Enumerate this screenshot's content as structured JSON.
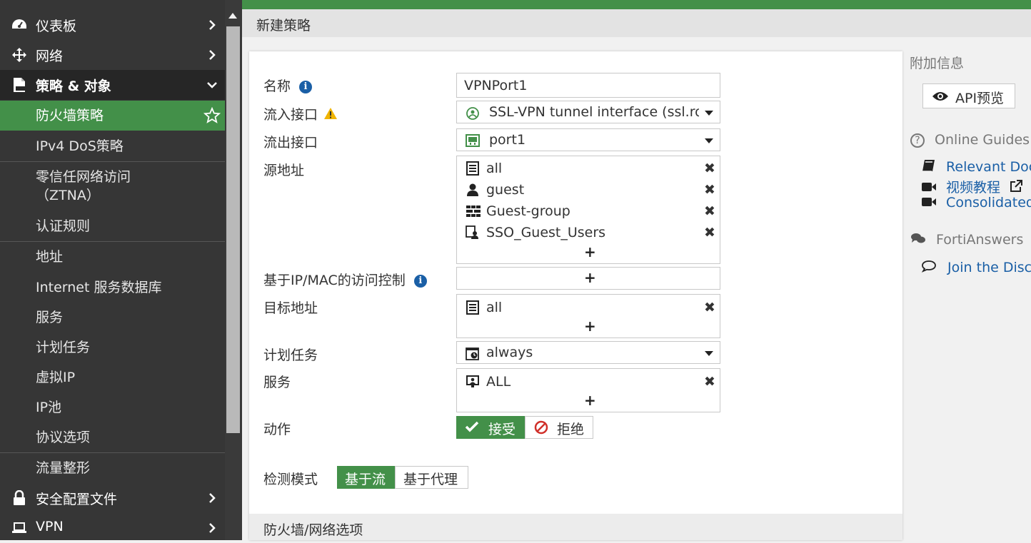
{
  "sidebar": {
    "top": [
      {
        "label": "仪表板",
        "icon": "dashboard-icon"
      },
      {
        "label": "网络",
        "icon": "move-arrows-icon"
      },
      {
        "label": "策略 & 对象",
        "icon": "policy-document-icon"
      }
    ],
    "sub": [
      {
        "label": "防火墙策略"
      },
      {
        "label": "IPv4 DoS策略"
      },
      {
        "label": "零信任网络访问\n（ZTNA）"
      },
      {
        "label": "认证规则"
      },
      {
        "label": "地址"
      },
      {
        "label": "Internet 服务数据库"
      },
      {
        "label": "服务"
      },
      {
        "label": "计划任务"
      },
      {
        "label": "虚拟IP"
      },
      {
        "label": "IP池"
      },
      {
        "label": "协议选项"
      },
      {
        "label": "流量整形"
      }
    ],
    "bottom": [
      {
        "label": "安全配置文件",
        "icon": "lock-icon"
      },
      {
        "label": "VPN",
        "icon": "laptop-icon"
      }
    ]
  },
  "header": {
    "title": "新建策略"
  },
  "form": {
    "name": {
      "label": "名称",
      "value": "VPNPort1"
    },
    "incoming": {
      "label": "流入接口",
      "value": "SSL-VPN tunnel interface (ssl.root)"
    },
    "outgoing": {
      "label": "流出接口",
      "value": "port1"
    },
    "source": {
      "label": "源地址",
      "items": [
        "all",
        "guest",
        "Guest-group",
        "SSO_Guest_Users"
      ]
    },
    "ipmac": {
      "label": "基于IP/MAC的访问控制"
    },
    "destination": {
      "label": "目标地址",
      "items": [
        "all"
      ]
    },
    "schedule": {
      "label": "计划任务",
      "value": "always"
    },
    "service": {
      "label": "服务",
      "items": [
        "ALL"
      ]
    },
    "action": {
      "label": "动作",
      "accept": "接受",
      "deny": "拒绝"
    },
    "inspection": {
      "label": "检测模式",
      "flow": "基于流",
      "proxy": "基于代理"
    },
    "section": "防火墙/网络选项",
    "plus": "+",
    "remove": "✖"
  },
  "right": {
    "title": "附加信息",
    "api_button": "API预览",
    "online_guides": "Online Guides",
    "links": [
      "Relevant Docu",
      "视频教程",
      "Consolidated"
    ],
    "fortianswers": "FortiAnswers",
    "join": "Join the Discu"
  },
  "colors": {
    "accent": "#439049",
    "sidebar": "#363636",
    "link": "#1a5fa6"
  }
}
